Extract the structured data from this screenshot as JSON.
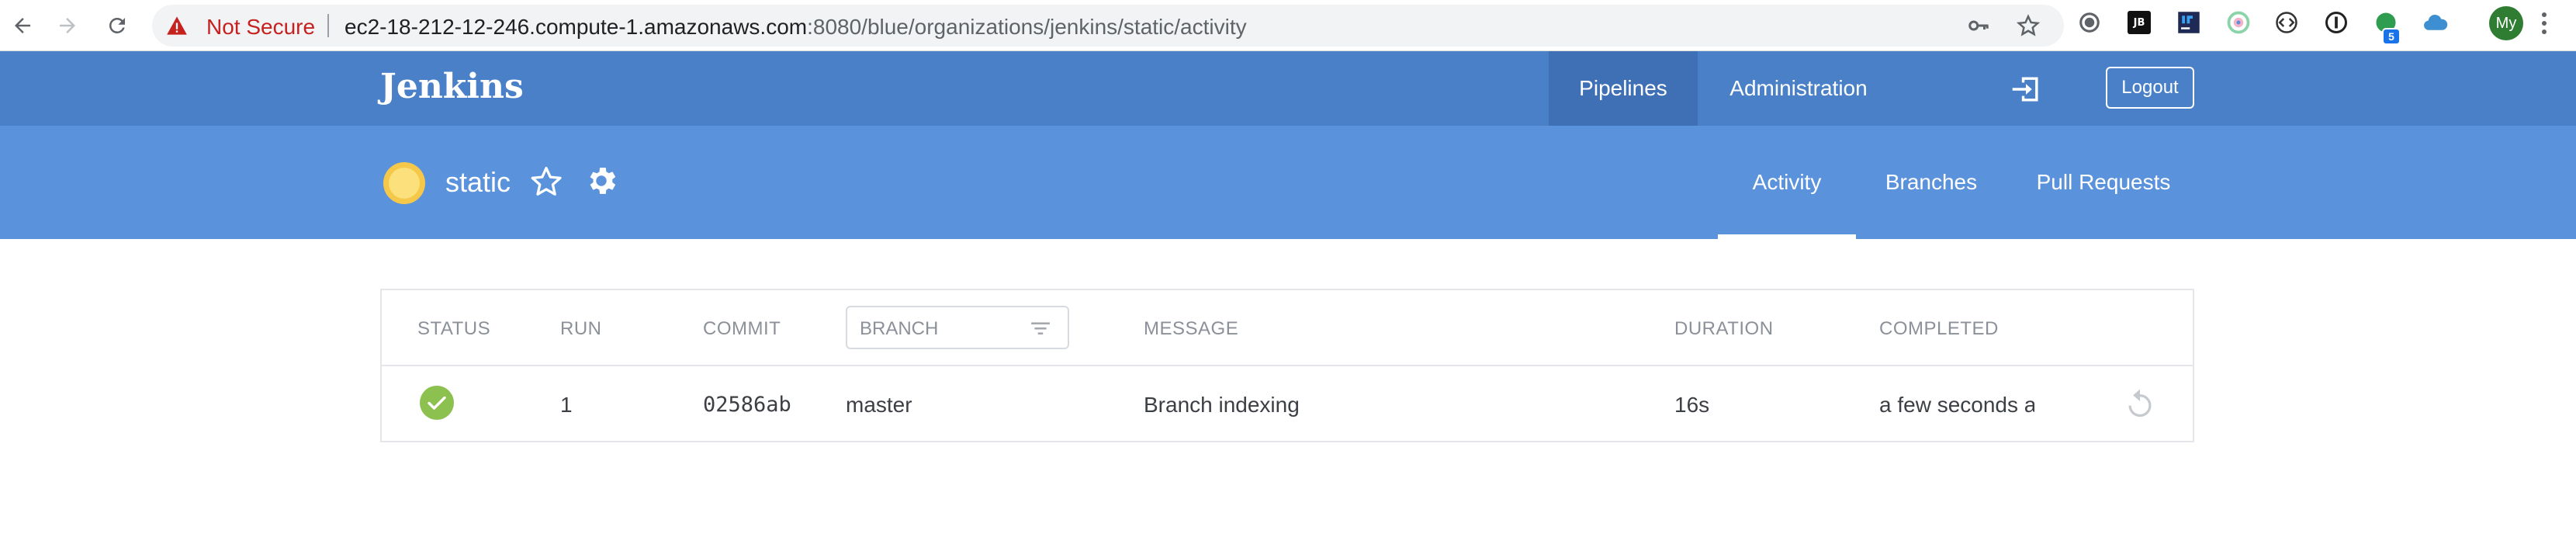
{
  "browser": {
    "security_label": "Not Secure",
    "url_host": "ec2-18-212-12-246.compute-1.amazonaws.com",
    "url_rest": ":8080/blue/organizations/jenkins/static/activity",
    "extensions": [
      "circle-ext-icon",
      "jetbrains-ext-icon",
      "jb-ide-ext-icon",
      "colorful-ext-icon",
      "code-ext-icon",
      "info-ext-icon",
      "green-ext-icon",
      "cloud-ext-icon"
    ],
    "jetbrains_text": "JB",
    "extension_badge": "5",
    "profile_initials": "My"
  },
  "header": {
    "brand": "Jenkins",
    "nav_pipelines": "Pipelines",
    "nav_administration": "Administration",
    "logout_label": "Logout"
  },
  "pipeline": {
    "name": "static",
    "status_color": "#f7d35a",
    "tabs": {
      "activity": "Activity",
      "branches": "Branches",
      "pull_requests": "Pull Requests"
    }
  },
  "table": {
    "columns": {
      "status": "STATUS",
      "run": "RUN",
      "commit": "COMMIT",
      "branch_placeholder": "BRANCH",
      "message": "MESSAGE",
      "duration": "DURATION",
      "completed": "COMPLETED"
    },
    "rows": [
      {
        "status": "success",
        "run": "1",
        "commit": "02586ab",
        "branch": "master",
        "message": "Branch indexing",
        "duration": "16s",
        "completed": "a few seconds ago"
      }
    ]
  },
  "colors": {
    "header_bg": "#4a80c8",
    "subheader_bg": "#5b92dc",
    "success": "#8cc04f"
  }
}
